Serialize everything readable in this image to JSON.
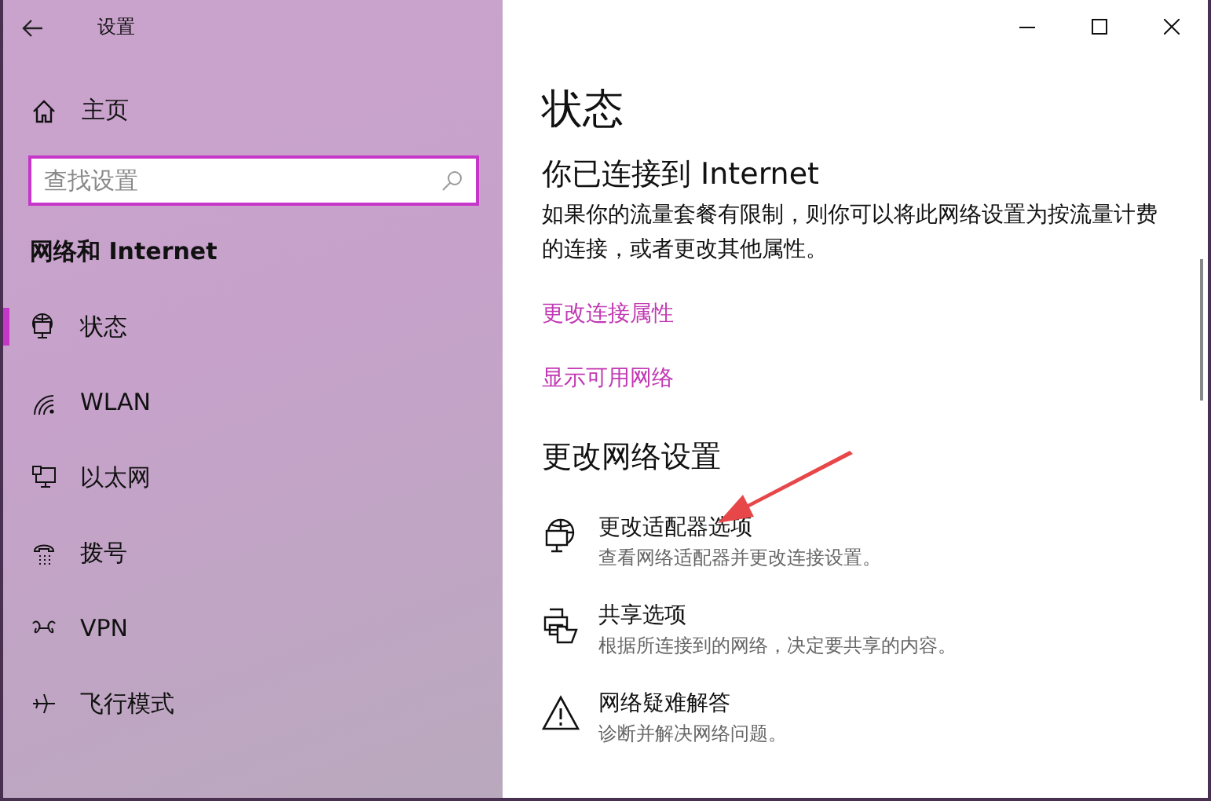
{
  "window": {
    "title": "设置"
  },
  "sidebar": {
    "home": "主页",
    "search": {
      "placeholder": "查找设置"
    },
    "section": "网络和 Internet",
    "items": [
      {
        "kind": "status",
        "label": "状态",
        "selected": true
      },
      {
        "kind": "wlan",
        "label": "WLAN",
        "selected": false
      },
      {
        "kind": "ethernet",
        "label": "以太网",
        "selected": false
      },
      {
        "kind": "dialup",
        "label": "拨号",
        "selected": false
      },
      {
        "kind": "vpn",
        "label": "VPN",
        "selected": false
      },
      {
        "kind": "airplane",
        "label": "飞行模式",
        "selected": false
      }
    ]
  },
  "main": {
    "title": "状态",
    "connected_heading": "你已连接到 Internet",
    "description": "如果你的流量套餐有限制，则你可以将此网络设置为按流量计费的连接，或者更改其他属性。",
    "links": [
      "更改连接属性",
      "显示可用网络"
    ],
    "section": "更改网络设置",
    "options": [
      {
        "kind": "adapter",
        "title": "更改适配器选项",
        "subtitle": "查看网络适配器并更改连接设置。"
      },
      {
        "kind": "sharing",
        "title": "共享选项",
        "subtitle": "根据所连接到的网络，决定要共享的内容。"
      },
      {
        "kind": "troubleshoot",
        "title": "网络疑难解答",
        "subtitle": "诊断并解决网络问题。"
      }
    ]
  }
}
